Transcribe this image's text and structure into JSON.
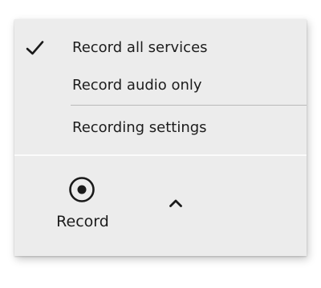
{
  "menu": {
    "items": [
      {
        "label": "Record all services",
        "checked": true
      },
      {
        "label": "Record audio only",
        "checked": false
      },
      {
        "label": "Recording settings",
        "checked": false
      }
    ]
  },
  "footer": {
    "record_label": "Record",
    "record_icon": "record-icon",
    "expand_icon": "chevron-up-icon"
  },
  "colors": {
    "panel_background": "#ececec",
    "text": "#1c1c1c",
    "divider": "#b9b9b9"
  }
}
